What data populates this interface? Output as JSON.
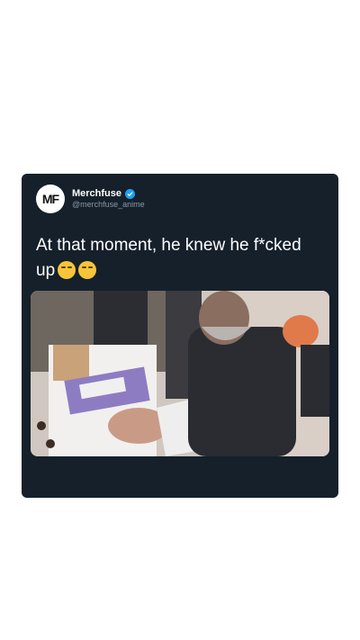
{
  "account": {
    "name": "Merchfuse",
    "handle": "@merchfuse_anime",
    "avatar_text": "MF",
    "verified": true
  },
  "tweet": {
    "text": "At that moment, he knew he f*cked up",
    "emojis": [
      "face-with-tears-of-joy-icon",
      "face-with-tears-of-joy-icon"
    ]
  },
  "colors": {
    "card_bg": "#15202b",
    "text": "#ffffff",
    "secondary_text": "#8899a6",
    "verified_blue": "#1da1f2"
  }
}
